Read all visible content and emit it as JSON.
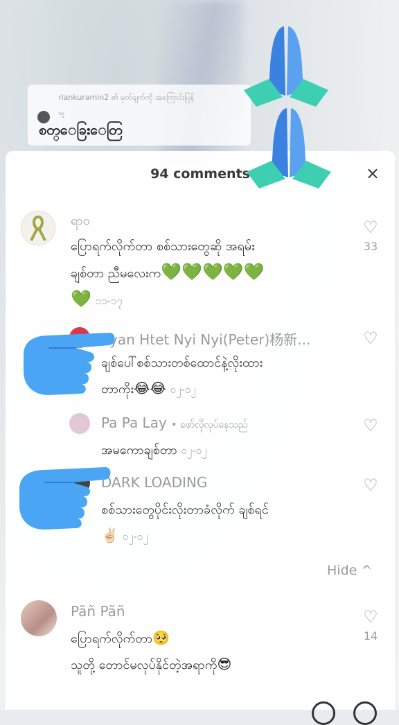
{
  "reply_card": {
    "top_line": "rlankuramin2 ၏ မှတ်ချက်ကို အကြောင်းပြန်",
    "mini_name": "သူ",
    "text": "စတ္ေခြးေတြ"
  },
  "sheet": {
    "title": "94 comments",
    "close_icon": "×"
  },
  "comments": [
    {
      "name": "ရာဝ",
      "text_line1": "ပြောရက်လိုက်တာ စစ်သားတွေဆို အရမ်း",
      "text_line2": "ချစ်တာ ညီမလေးက",
      "hearts": "💚💚💚💚💚",
      "hearts2": "💚",
      "date": "၁၁-၁၇",
      "likes": "33"
    },
    {
      "name": "Pyan Htet Nyi Nyi(Peter)杨新...",
      "text_line1": "ချစ်ပေါ်စစ်သားတစ်ထောင်နဲ့လိုးထား",
      "text_line2": "တာကိုး",
      "emoji": "😂😂",
      "date": "၀၂-၀၂"
    },
    {
      "name": "Pa Pa Lay",
      "sub": "• ဖော်လိုလုပ်နေသည်",
      "text_line1": "အမကောချစ်တာ",
      "date": "၀၂-၀၂"
    },
    {
      "name": "DARK LOADING",
      "text_line1": "စစ်သားတွေပိုင်းလိုးတာခံလိုက် ချစ်ရင်",
      "emoji": "✌🏻",
      "date": "၀၂-၀၂"
    },
    {
      "name": "Pãñ Pãñ",
      "text_line1": "ပြောရက်လိုက်တာ",
      "emoji1": "🥺",
      "text_line2": "သူတို့ တောင်မလုပ်နိုင်တဲ့အရာကို",
      "emoji2": "😎",
      "likes": "14"
    }
  ],
  "hide_label": "Hide ^",
  "heart_glyph": "♡",
  "colors": {
    "accent_green": "#76b82a",
    "hand_blue": "#3b8ee8",
    "cuff_teal": "#3ecfb2"
  }
}
